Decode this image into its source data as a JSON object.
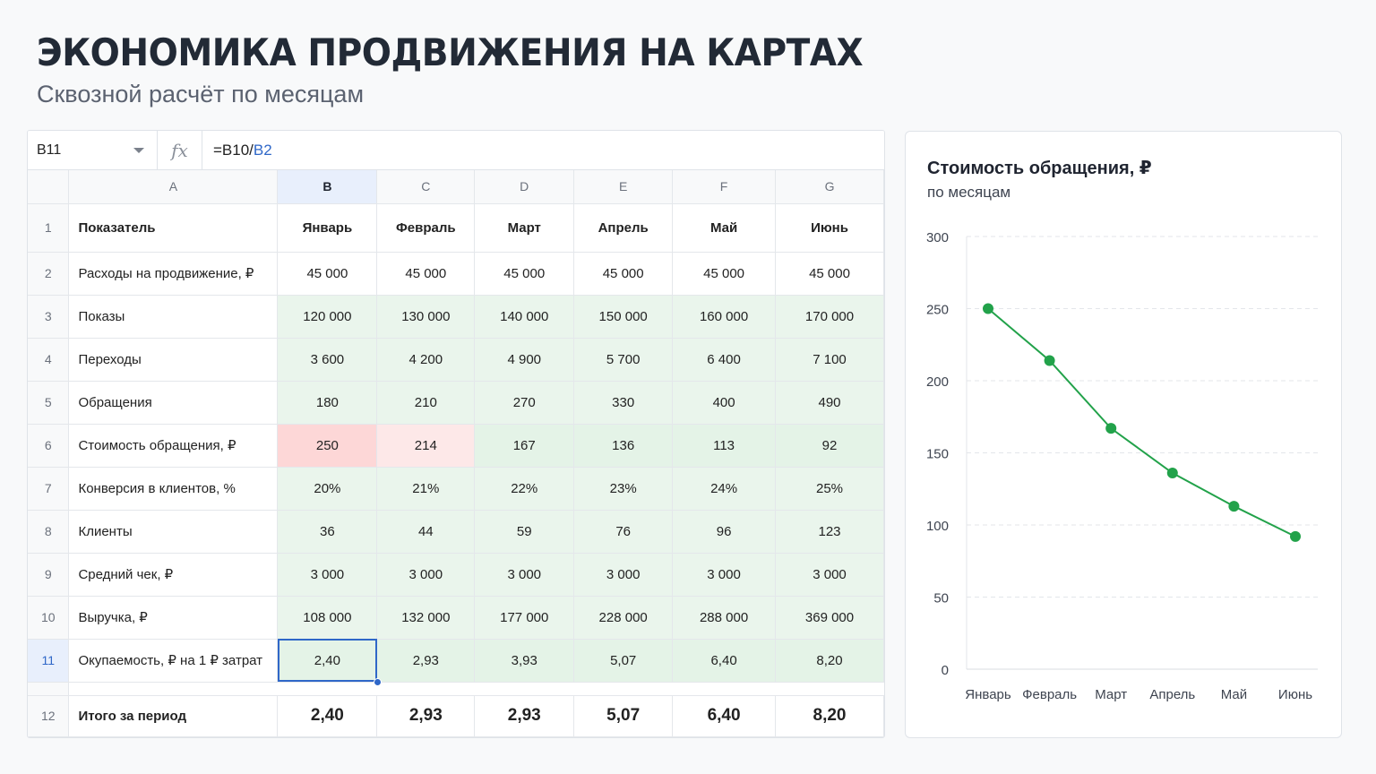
{
  "page": {
    "title": "ЭКОНОМИКА ПРОДВИЖЕНИЯ НА КАРТАХ",
    "subtitle": "Сквозной расчёт по месяцам"
  },
  "formula_bar": {
    "cell_ref": "B11",
    "fx": "fx",
    "formula_prefix": "=B10/",
    "formula_ref": "B2"
  },
  "sheet": {
    "columns": [
      "A",
      "B",
      "C",
      "D",
      "E",
      "F",
      "G"
    ],
    "selected_column": "B",
    "selected_row": "11",
    "rows": [
      {
        "num": "1",
        "label": "Показатель",
        "values": [
          "Январь",
          "Февраль",
          "Март",
          "Апрель",
          "Май",
          "Июнь"
        ]
      },
      {
        "num": "2",
        "label": "Расходы на продвижение, ₽",
        "values": [
          "45 000",
          "45 000",
          "45 000",
          "45 000",
          "45 000",
          "45 000"
        ]
      },
      {
        "num": "3",
        "label": "Показы",
        "values": [
          "120 000",
          "130 000",
          "140 000",
          "150 000",
          "160 000",
          "170 000"
        ]
      },
      {
        "num": "4",
        "label": "Переходы",
        "values": [
          "3 600",
          "4 200",
          "4 900",
          "5 700",
          "6 400",
          "7 100"
        ]
      },
      {
        "num": "5",
        "label": "Обращения",
        "values": [
          "180",
          "210",
          "270",
          "330",
          "400",
          "490"
        ]
      },
      {
        "num": "6",
        "label": "Стоимость обращения, ₽",
        "values": [
          "250",
          "214",
          "167",
          "136",
          "113",
          "92"
        ]
      },
      {
        "num": "7",
        "label": "Конверсия в клиентов, %",
        "values": [
          "20%",
          "21%",
          "22%",
          "23%",
          "24%",
          "25%"
        ]
      },
      {
        "num": "8",
        "label": "Клиенты",
        "values": [
          "36",
          "44",
          "59",
          "76",
          "96",
          "123"
        ]
      },
      {
        "num": "9",
        "label": "Средний чек, ₽",
        "values": [
          "3 000",
          "3 000",
          "3 000",
          "3 000",
          "3 000",
          "3 000"
        ]
      },
      {
        "num": "10",
        "label": "Выручка, ₽",
        "values": [
          "108 000",
          "132 000",
          "177 000",
          "228 000",
          "288 000",
          "369 000"
        ]
      },
      {
        "num": "11",
        "label": "Окупаемость, ₽ на 1 ₽ затрат",
        "values": [
          "2,40",
          "2,93",
          "3,93",
          "5,07",
          "6,40",
          "8,20"
        ]
      }
    ],
    "total": {
      "num": "12",
      "label": "Итого за период",
      "values": [
        "2,40",
        "2,93",
        "2,93",
        "5,07",
        "6,40",
        "8,20"
      ]
    },
    "colors": {
      "green": "#eaf5ec",
      "red": "#fdd7d7",
      "red_light": "#fde8e8",
      "selection": "#2f67c8"
    }
  },
  "chart": {
    "title": "Стоимость обращения, ₽",
    "subtitle": "по месяцам"
  },
  "chart_data": {
    "type": "line",
    "categories": [
      "Январь",
      "Февраль",
      "Март",
      "Апрель",
      "Май",
      "Июнь"
    ],
    "series": [
      {
        "values": [
          250,
          214,
          167,
          136,
          113,
          92
        ]
      }
    ],
    "title": "Стоимость обращения, ₽",
    "subtitle": "по месяцам",
    "xlabel": "",
    "ylabel": "",
    "ylim": [
      0,
      300
    ],
    "yticks": [
      0,
      50,
      100,
      150,
      200,
      250,
      300
    ],
    "grid": true,
    "color": "#22a24a"
  }
}
